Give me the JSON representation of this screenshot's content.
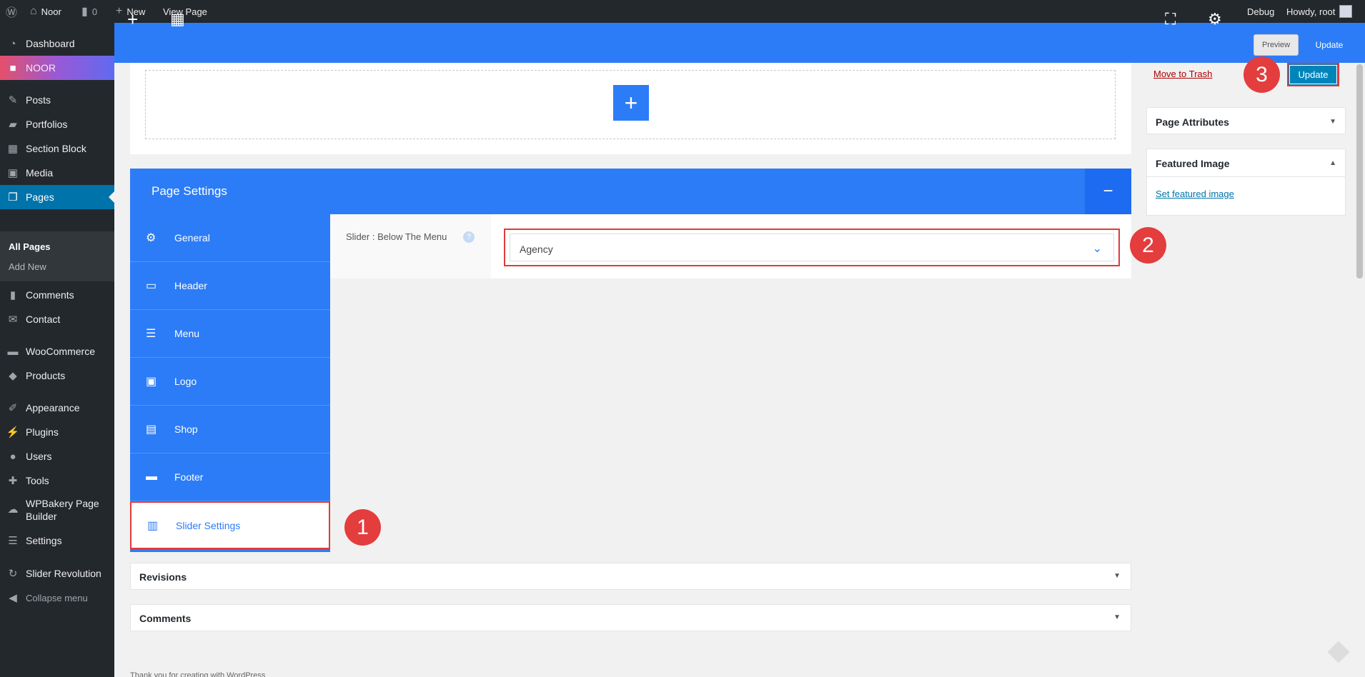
{
  "adminbar": {
    "site_name": "Noor",
    "comments_count": "0",
    "new_label": "New",
    "view_page_label": "View Page",
    "debug_label": "Debug",
    "howdy_label": "Howdy, root"
  },
  "sidebar": {
    "items": [
      {
        "label": "Dashboard",
        "icon": "dashboard-icon"
      },
      {
        "label": "NOOR",
        "icon": "noor-icon"
      },
      {
        "label": "Posts",
        "icon": "pin-icon"
      },
      {
        "label": "Portfolios",
        "icon": "folder-icon"
      },
      {
        "label": "Section Block",
        "icon": "grid-icon"
      },
      {
        "label": "Media",
        "icon": "media-icon"
      },
      {
        "label": "Pages",
        "icon": "pages-icon"
      },
      {
        "label": "Comments",
        "icon": "comment-icon"
      },
      {
        "label": "Contact",
        "icon": "mail-icon"
      },
      {
        "label": "WooCommerce",
        "icon": "woo-icon"
      },
      {
        "label": "Products",
        "icon": "box-icon"
      },
      {
        "label": "Appearance",
        "icon": "brush-icon"
      },
      {
        "label": "Plugins",
        "icon": "plug-icon"
      },
      {
        "label": "Users",
        "icon": "user-icon"
      },
      {
        "label": "Tools",
        "icon": "wrench-icon"
      },
      {
        "label": "WPBakery Page Builder",
        "icon": "cloud-icon"
      },
      {
        "label": "Settings",
        "icon": "sliders-icon"
      },
      {
        "label": "Slider Revolution",
        "icon": "refresh-icon"
      }
    ],
    "submenu": [
      "All Pages",
      "Add New"
    ],
    "collapse_label": "Collapse menu"
  },
  "toolbar": {
    "preview_label": "Preview",
    "update_label": "Update"
  },
  "page_settings": {
    "title": "Page Settings",
    "minimize_symbol": "−",
    "nav": [
      {
        "label": "General",
        "icon": "gear-icon"
      },
      {
        "label": "Header",
        "icon": "window-icon"
      },
      {
        "label": "Menu",
        "icon": "menu-icon"
      },
      {
        "label": "Logo",
        "icon": "image-icon"
      },
      {
        "label": "Shop",
        "icon": "store-icon"
      },
      {
        "label": "Footer",
        "icon": "footer-icon"
      },
      {
        "label": "Slider Settings",
        "icon": "slider-icon"
      }
    ],
    "field_label": "Slider : Below The Menu",
    "help_symbol": "?",
    "select_value": "Agency"
  },
  "accordions": {
    "revisions": "Revisions",
    "comments": "Comments"
  },
  "right_sidebar": {
    "move_to_trash": "Move to Trash",
    "update_label": "Update",
    "page_attributes": "Page Attributes",
    "featured_image": "Featured Image",
    "set_featured_image": "Set featured image"
  },
  "badges": [
    "1",
    "2",
    "3"
  ],
  "footer_partial": "Thank you for creating with WordPress"
}
